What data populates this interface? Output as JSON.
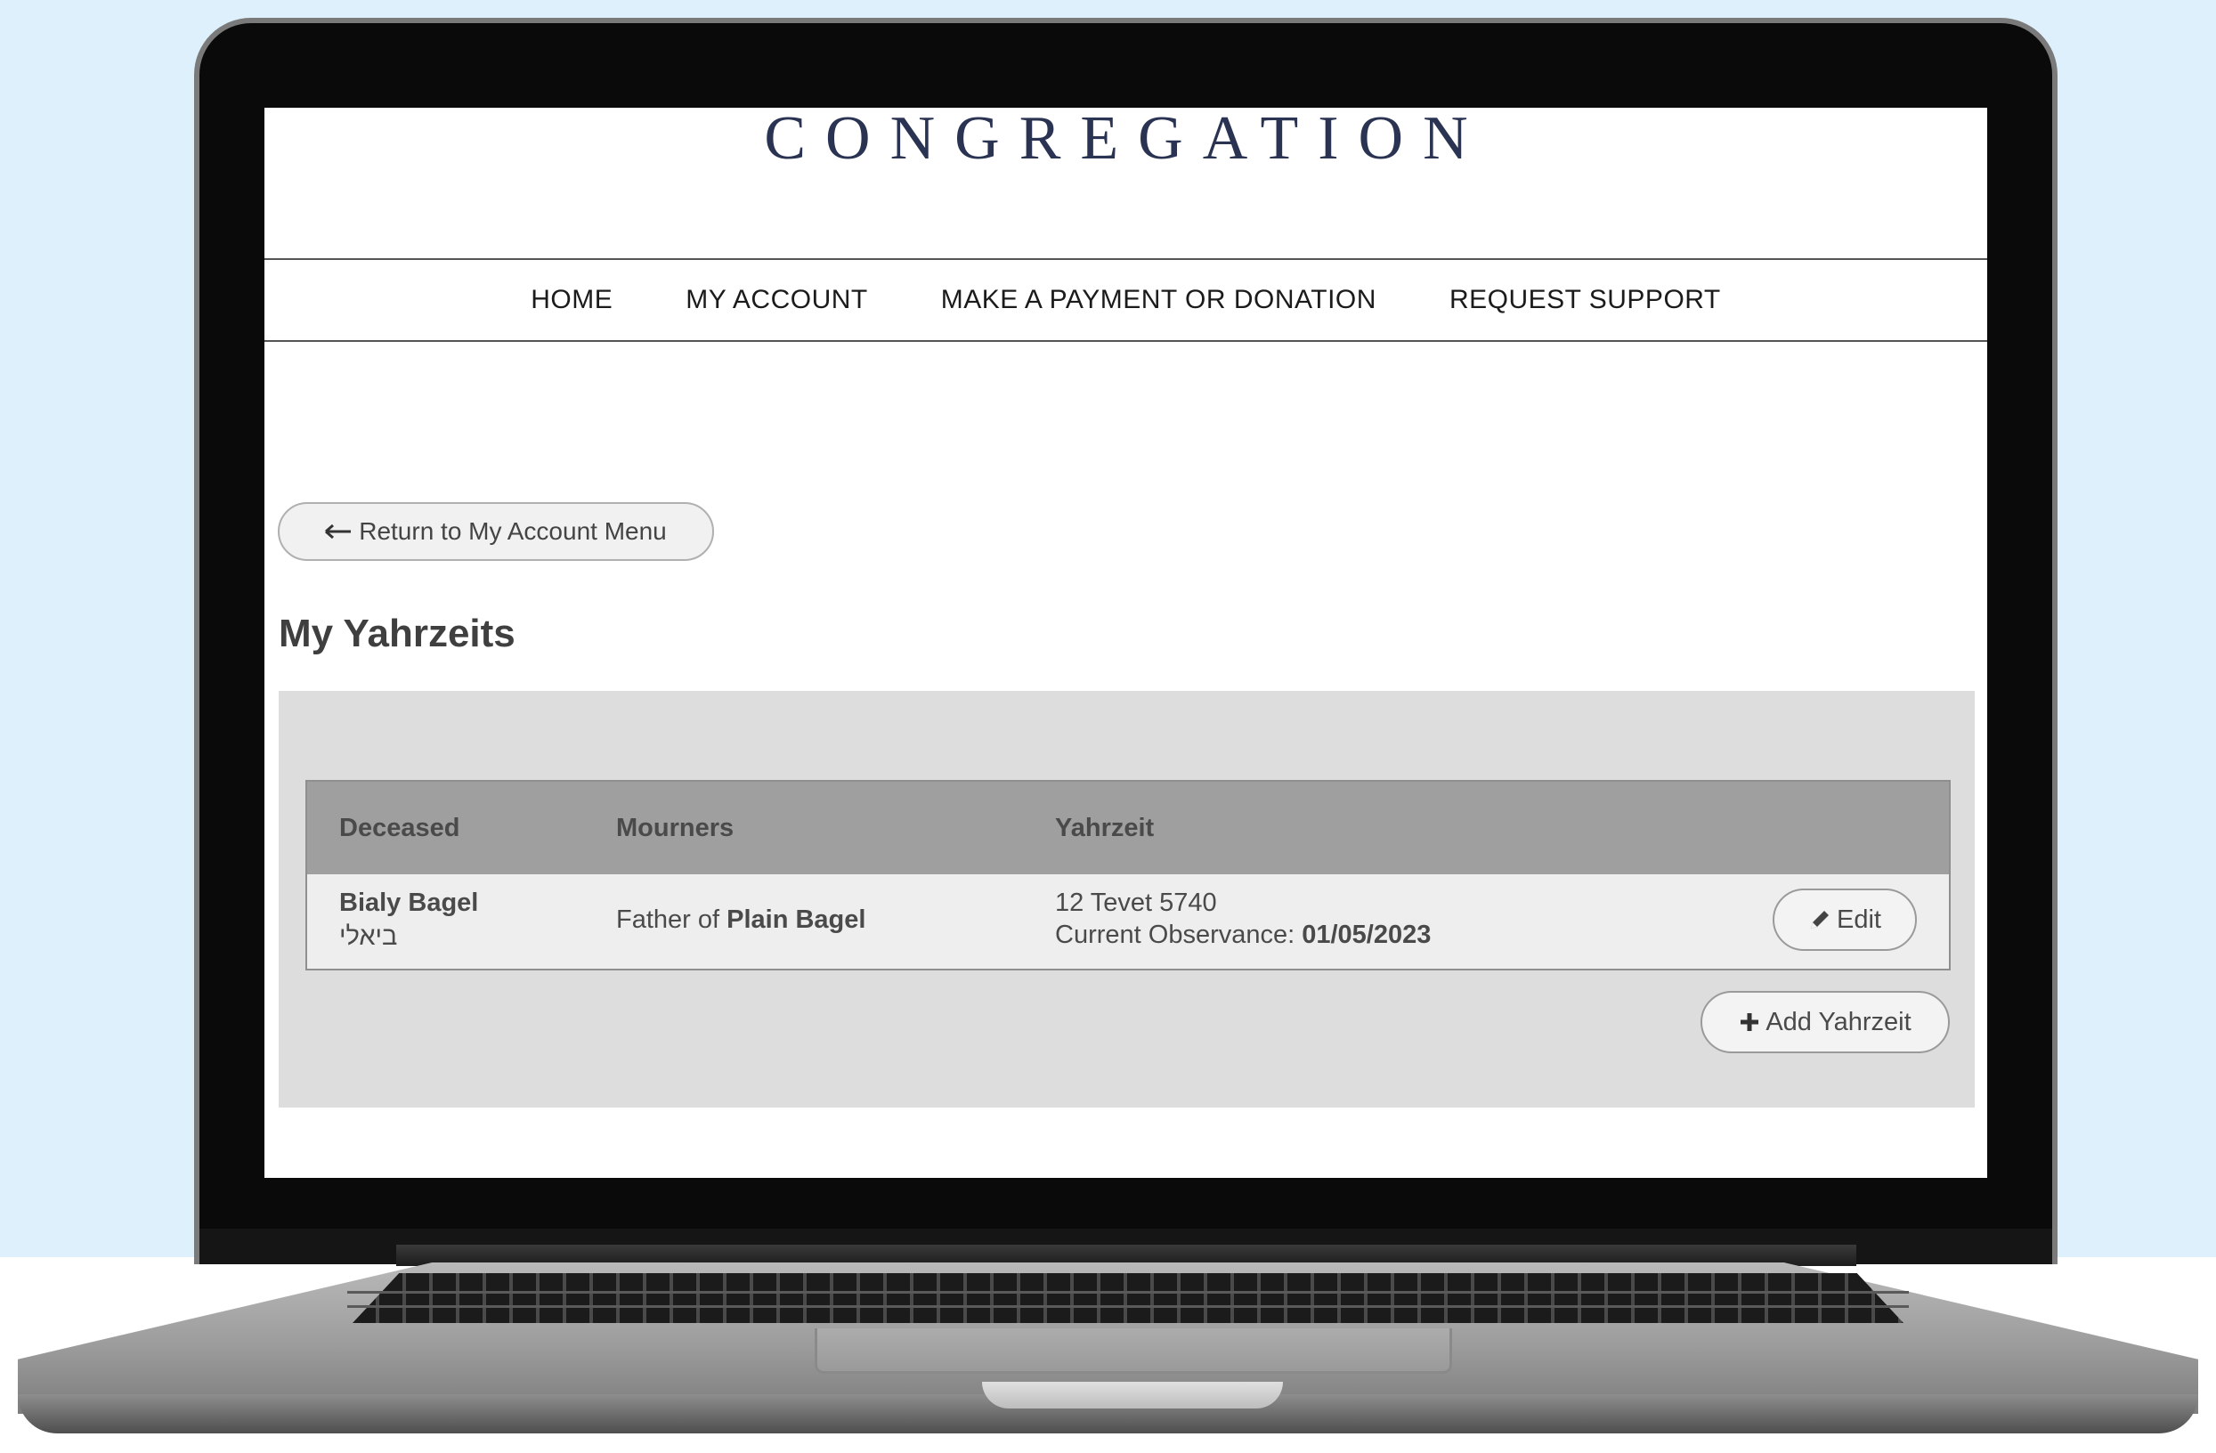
{
  "site": {
    "logo_text": "CONGREGATION",
    "nav": [
      {
        "label": "HOME"
      },
      {
        "label": "MY ACCOUNT"
      },
      {
        "label": "MAKE A PAYMENT OR DONATION"
      },
      {
        "label": "REQUEST SUPPORT"
      }
    ]
  },
  "page": {
    "return_label": "Return to My Account Menu",
    "title": "My Yahrzeits",
    "add_label": "Add Yahrzeit"
  },
  "table": {
    "headers": [
      "Deceased",
      "Mourners",
      "Yahrzeit"
    ],
    "rows": [
      {
        "deceased_name": "Bialy Bagel",
        "deceased_hebrew": "ביאלי",
        "mourner_prefix": "Father of",
        "mourner_name": "Plain Bagel",
        "hebrew_date": "12 Tevet 5740",
        "observance_label": "Current Observance:",
        "observance_date": "01/05/2023",
        "edit_label": "Edit"
      }
    ]
  },
  "icons": {
    "return": "arrow-left-icon",
    "edit": "pencil-icon",
    "add": "plus-icon"
  },
  "colors": {
    "background": "#ddf0fb",
    "logo": "#2a3352",
    "table_header": "#9f9f9f",
    "panel": "#dddddd"
  }
}
